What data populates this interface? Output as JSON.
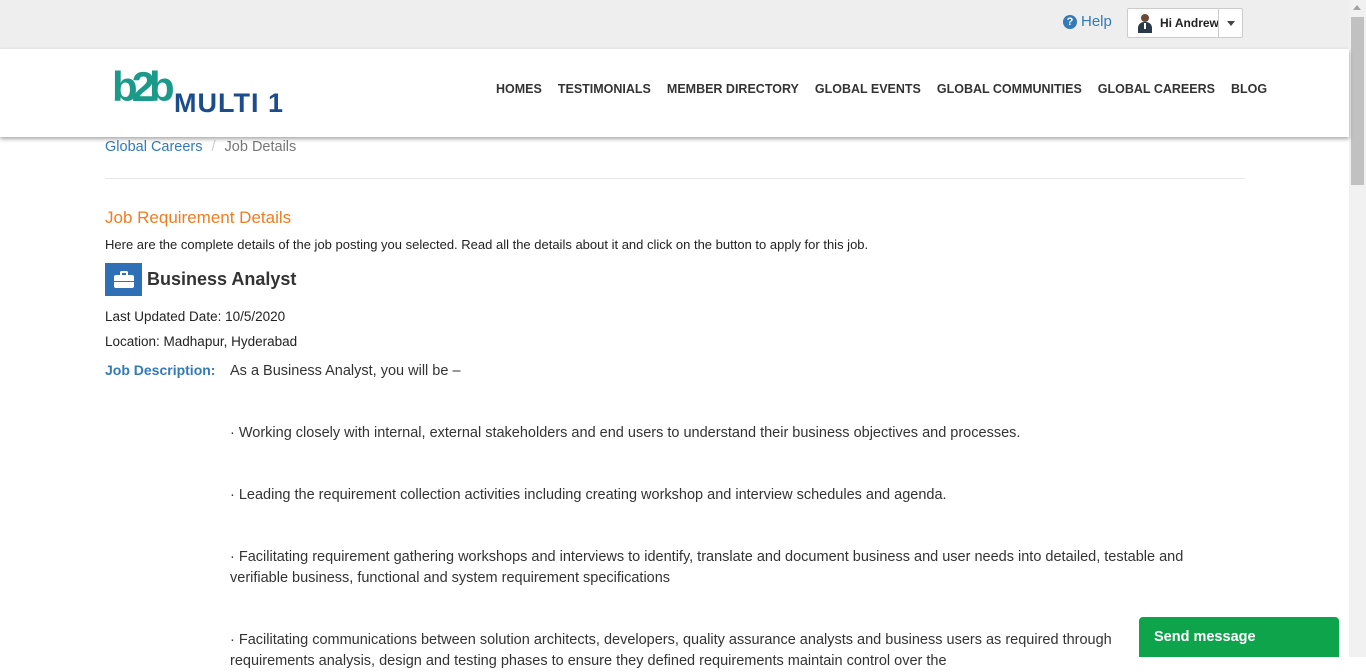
{
  "header": {
    "help_label": "Help",
    "help_icon": "question-circle-icon",
    "user_greeting": "Hi Andrew"
  },
  "navbar": {
    "logo_mark": "b2b",
    "logo_text": "MULTI 1",
    "items": [
      {
        "label": "HOMES"
      },
      {
        "label": "TESTIMONIALS"
      },
      {
        "label": "MEMBER DIRECTORY"
      },
      {
        "label": "GLOBAL EVENTS"
      },
      {
        "label": "GLOBAL COMMUNITIES"
      },
      {
        "label": "GLOBAL CAREERS"
      },
      {
        "label": "BLOG"
      }
    ]
  },
  "breadcrumb": {
    "parent": "Global Careers",
    "separator": "/",
    "current": "Job Details"
  },
  "main": {
    "section_title": "Job Requirement Details",
    "intro": "Here are the complete details of the job posting you selected. Read all the details about it and click on the button to apply for this job.",
    "job_title": "Business Analyst",
    "last_updated": "Last Updated Date: 10/5/2020",
    "location": "Location: Madhapur, Hyderabad",
    "description_label": "Job Description:",
    "description": [
      "As a Business Analyst, you will be –",
      "· Working closely with internal, external stakeholders and end users to understand their business objectives and processes.",
      "· Leading the requirement collection activities including creating workshop and interview schedules and agenda.",
      "· Facilitating requirement gathering workshops and interviews to identify, translate and document business and user needs into detailed, testable and verifiable business, functional and system requirement specifications",
      "· Facilitating communications between solution architects, developers, quality assurance analysts and business users as required through",
      "requirements analysis, design and testing phases to ensure they defined requirements maintain control over the"
    ]
  },
  "chat": {
    "send_label": "Send message"
  },
  "colors": {
    "accent_blue": "#337ab7",
    "title_orange": "#f07c20",
    "chat_green": "#0ea44b",
    "logo_teal": "#1b9a8a",
    "logo_navy": "#1b4d8c"
  }
}
